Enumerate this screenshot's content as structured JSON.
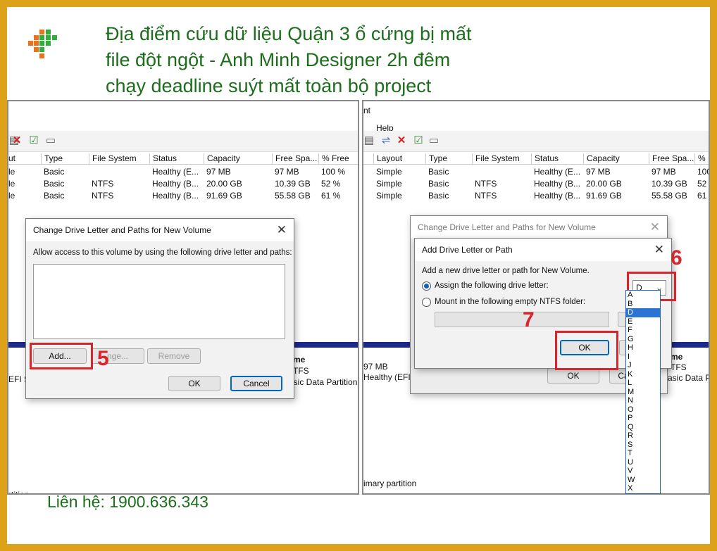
{
  "header": {
    "title_lines": [
      "Địa điểm cứu dữ liệu Quận 3 ổ cứng bị mất",
      "file đột ngột - Anh Minh Designer 2h đêm",
      "chạy deadline suýt mất toàn bộ project"
    ],
    "logo_icon": "pixel-grid-logo-icon"
  },
  "footer": {
    "contact": "Liên hệ: 1900.636.343"
  },
  "colors": {
    "frame": "#dea21a",
    "title_text": "#1c6e1c",
    "highlight": "#d8242b",
    "selection": "#2b74d3"
  },
  "left": {
    "toolbar_icons": [
      "disk-icon",
      "delete-icon",
      "checkbox-icon",
      "properties-icon"
    ],
    "columns": [
      "ut",
      "Type",
      "File System",
      "Status",
      "Capacity",
      "Free Spa...",
      "% Free"
    ],
    "rows": [
      [
        "le",
        "Basic",
        "",
        "Healthy (E...",
        "97 MB",
        "97 MB",
        "100 %"
      ],
      [
        "le",
        "Basic",
        "NTFS",
        "Healthy (B...",
        "20.00 GB",
        "10.39 GB",
        "52 %"
      ],
      [
        "le",
        "Basic",
        "NTFS",
        "Healthy (B...",
        "91.69 GB",
        "55.58 GB",
        "61 %"
      ]
    ],
    "bottom": {
      "efi": "EFI S",
      "name_label": "me",
      "fs": "TFS",
      "part_type": "asic Data Partition",
      "footer": "rtition"
    },
    "dialog": {
      "title": "Change Drive Letter and Paths for New Volume",
      "description": "Allow access to this volume by using the following drive letter and paths:",
      "add_label": "Add...",
      "change_label": "nge...",
      "remove_label": "Remove",
      "ok_label": "OK",
      "cancel_label": "Cancel",
      "step": "5"
    }
  },
  "right": {
    "menu": {
      "partial": "nt",
      "help": "Help"
    },
    "toolbar_icons": [
      "disk-icon",
      "connect-icon",
      "delete-icon",
      "checkbox-icon",
      "properties-icon"
    ],
    "columns": [
      "Layout",
      "Type",
      "File System",
      "Status",
      "Capacity",
      "Free Spa...",
      "% F"
    ],
    "rows": [
      [
        "Simple",
        "Basic",
        "",
        "Healthy (E...",
        "97 MB",
        "97 MB",
        "100"
      ],
      [
        "Simple",
        "Basic",
        "NTFS",
        "Healthy (B...",
        "20.00 GB",
        "10.39 GB",
        "52 9"
      ],
      [
        "Simple",
        "Basic",
        "NTFS",
        "Healthy (B...",
        "91.69 GB",
        "55.58 GB",
        "61 9"
      ]
    ],
    "bottom": {
      "size": "97 MB",
      "status": "Healthy (EFI S",
      "name_label": "me",
      "fs": "TFS",
      "part_type": "asic Data Pa",
      "footer": "imary partition"
    },
    "bg_dialog": {
      "title": "Change Drive Letter and Paths for New Volume",
      "ok_label": "OK",
      "cancel_partial": "Ca"
    },
    "dialog": {
      "title": "Add Drive Letter or Path",
      "description": "Add a new drive letter or path for New Volume.",
      "assign_label": "Assign the following drive letter:",
      "mount_label": "Mount in the following empty NTFS folder:",
      "browse_partial": "Bro",
      "selected_letter": "D",
      "ok_label": "OK",
      "cancel_partial": "Ca",
      "step_dropdown": "6",
      "step_ok": "7"
    },
    "drive_letters": [
      "A",
      "B",
      "D",
      "E",
      "F",
      "G",
      "H",
      "I",
      "J",
      "K",
      "L",
      "M",
      "N",
      "O",
      "P",
      "Q",
      "R",
      "S",
      "T",
      "U",
      "V",
      "W",
      "X"
    ]
  }
}
